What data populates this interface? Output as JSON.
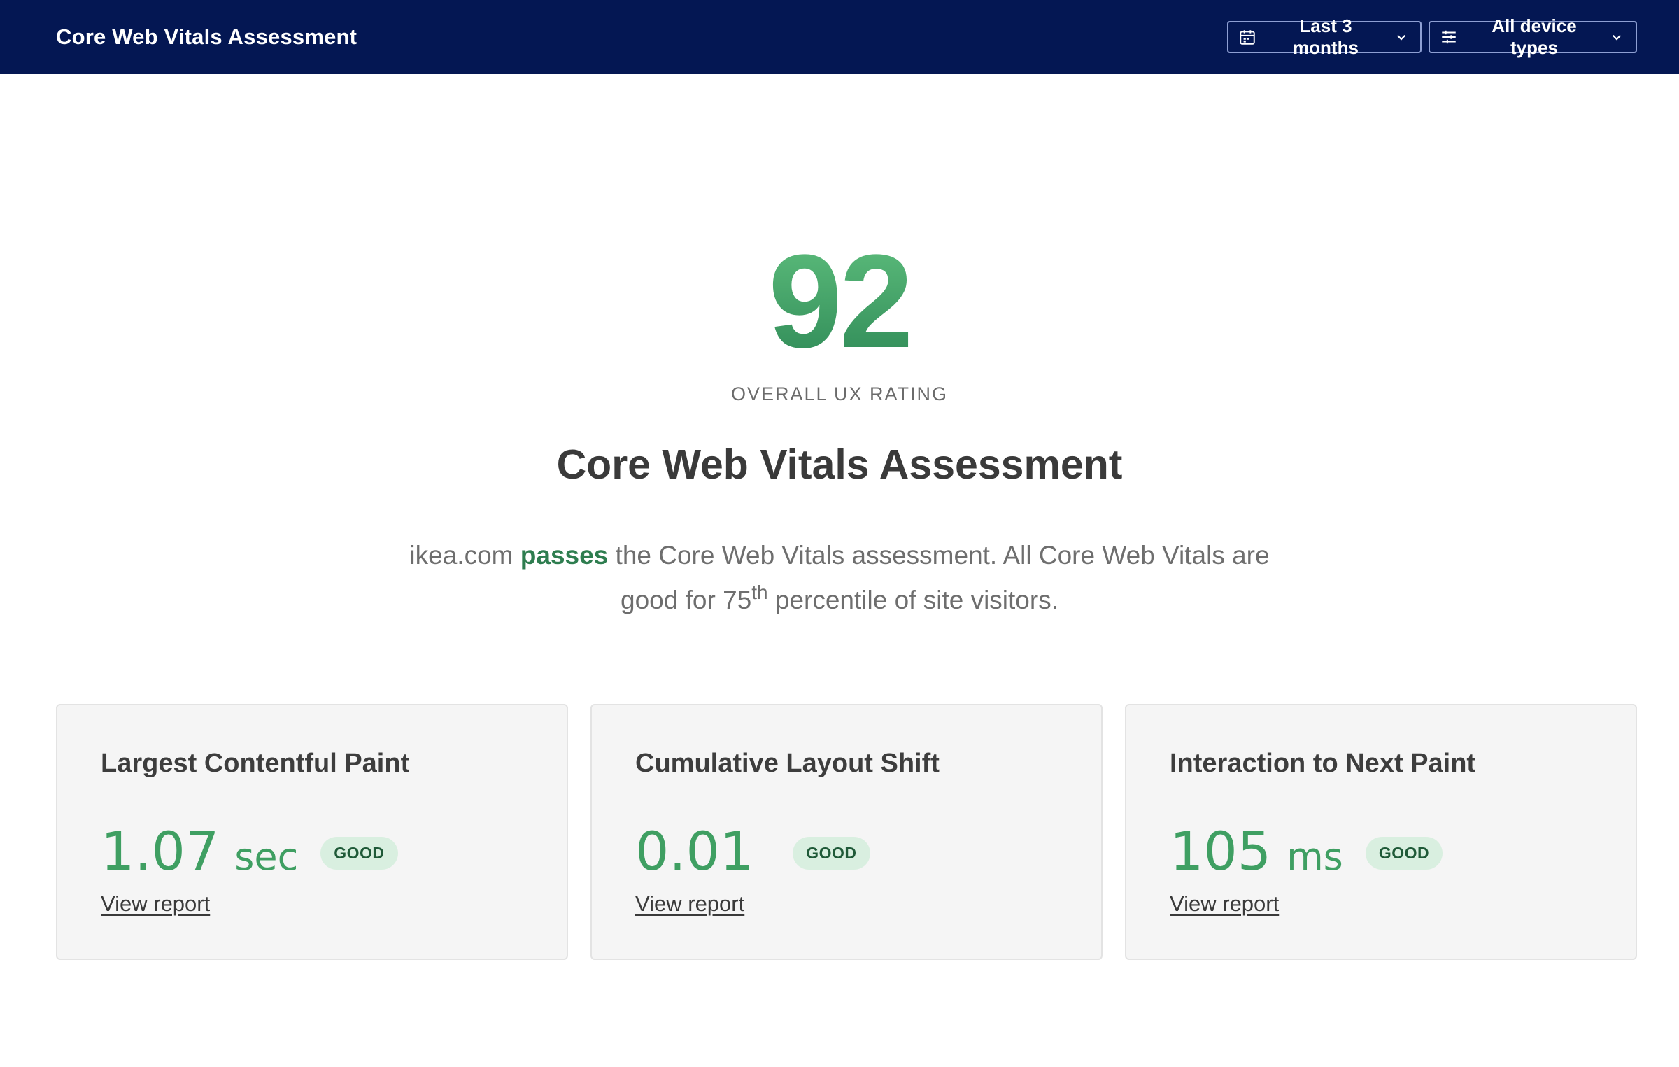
{
  "header": {
    "title": "Core Web Vitals Assessment",
    "date_range_label": "Last 3 months",
    "device_filter_label": "All device types"
  },
  "score": {
    "value": "92",
    "label": "OVERALL UX RATING"
  },
  "assessment": {
    "heading": "Core Web Vitals Assessment",
    "site": "ikea.com",
    "status_word": "passes",
    "text_part1": "the Core Web Vitals assessment. All Core Web Vitals are good for 75",
    "superscript": "th",
    "text_part2": "percentile of site visitors."
  },
  "metrics": [
    {
      "title": "Largest Contentful Paint",
      "value": "1.07",
      "unit": "sec",
      "status": "GOOD",
      "link": "View report"
    },
    {
      "title": "Cumulative Layout Shift",
      "value": "0.01",
      "unit": "",
      "status": "GOOD",
      "link": "View report"
    },
    {
      "title": "Interaction to Next Paint",
      "value": "105",
      "unit": "ms",
      "status": "GOOD",
      "link": "View report"
    }
  ],
  "colors": {
    "header_bg": "#041753",
    "good_green": "#3f9f62",
    "badge_bg": "#d9efe0",
    "card_bg": "#f5f5f5"
  }
}
